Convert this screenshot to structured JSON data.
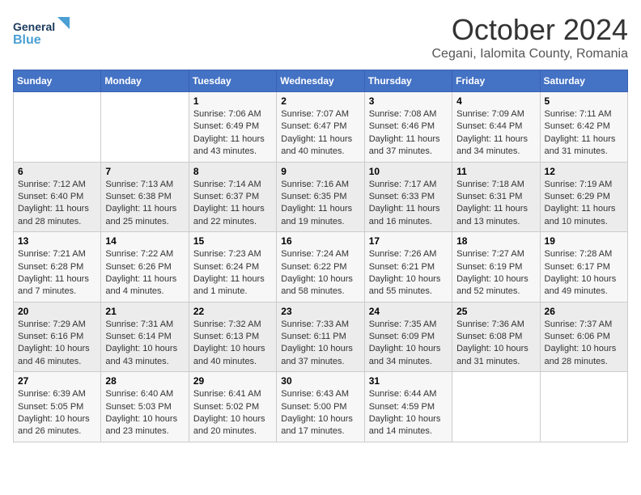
{
  "logo": {
    "line1": "General",
    "line2": "Blue"
  },
  "title": "October 2024",
  "location": "Cegani, Ialomita County, Romania",
  "days_header": [
    "Sunday",
    "Monday",
    "Tuesday",
    "Wednesday",
    "Thursday",
    "Friday",
    "Saturday"
  ],
  "weeks": [
    [
      {
        "day": "",
        "sunrise": "",
        "sunset": "",
        "daylight": ""
      },
      {
        "day": "",
        "sunrise": "",
        "sunset": "",
        "daylight": ""
      },
      {
        "day": "1",
        "sunrise": "Sunrise: 7:06 AM",
        "sunset": "Sunset: 6:49 PM",
        "daylight": "Daylight: 11 hours and 43 minutes."
      },
      {
        "day": "2",
        "sunrise": "Sunrise: 7:07 AM",
        "sunset": "Sunset: 6:47 PM",
        "daylight": "Daylight: 11 hours and 40 minutes."
      },
      {
        "day": "3",
        "sunrise": "Sunrise: 7:08 AM",
        "sunset": "Sunset: 6:46 PM",
        "daylight": "Daylight: 11 hours and 37 minutes."
      },
      {
        "day": "4",
        "sunrise": "Sunrise: 7:09 AM",
        "sunset": "Sunset: 6:44 PM",
        "daylight": "Daylight: 11 hours and 34 minutes."
      },
      {
        "day": "5",
        "sunrise": "Sunrise: 7:11 AM",
        "sunset": "Sunset: 6:42 PM",
        "daylight": "Daylight: 11 hours and 31 minutes."
      }
    ],
    [
      {
        "day": "6",
        "sunrise": "Sunrise: 7:12 AM",
        "sunset": "Sunset: 6:40 PM",
        "daylight": "Daylight: 11 hours and 28 minutes."
      },
      {
        "day": "7",
        "sunrise": "Sunrise: 7:13 AM",
        "sunset": "Sunset: 6:38 PM",
        "daylight": "Daylight: 11 hours and 25 minutes."
      },
      {
        "day": "8",
        "sunrise": "Sunrise: 7:14 AM",
        "sunset": "Sunset: 6:37 PM",
        "daylight": "Daylight: 11 hours and 22 minutes."
      },
      {
        "day": "9",
        "sunrise": "Sunrise: 7:16 AM",
        "sunset": "Sunset: 6:35 PM",
        "daylight": "Daylight: 11 hours and 19 minutes."
      },
      {
        "day": "10",
        "sunrise": "Sunrise: 7:17 AM",
        "sunset": "Sunset: 6:33 PM",
        "daylight": "Daylight: 11 hours and 16 minutes."
      },
      {
        "day": "11",
        "sunrise": "Sunrise: 7:18 AM",
        "sunset": "Sunset: 6:31 PM",
        "daylight": "Daylight: 11 hours and 13 minutes."
      },
      {
        "day": "12",
        "sunrise": "Sunrise: 7:19 AM",
        "sunset": "Sunset: 6:29 PM",
        "daylight": "Daylight: 11 hours and 10 minutes."
      }
    ],
    [
      {
        "day": "13",
        "sunrise": "Sunrise: 7:21 AM",
        "sunset": "Sunset: 6:28 PM",
        "daylight": "Daylight: 11 hours and 7 minutes."
      },
      {
        "day": "14",
        "sunrise": "Sunrise: 7:22 AM",
        "sunset": "Sunset: 6:26 PM",
        "daylight": "Daylight: 11 hours and 4 minutes."
      },
      {
        "day": "15",
        "sunrise": "Sunrise: 7:23 AM",
        "sunset": "Sunset: 6:24 PM",
        "daylight": "Daylight: 11 hours and 1 minute."
      },
      {
        "day": "16",
        "sunrise": "Sunrise: 7:24 AM",
        "sunset": "Sunset: 6:22 PM",
        "daylight": "Daylight: 10 hours and 58 minutes."
      },
      {
        "day": "17",
        "sunrise": "Sunrise: 7:26 AM",
        "sunset": "Sunset: 6:21 PM",
        "daylight": "Daylight: 10 hours and 55 minutes."
      },
      {
        "day": "18",
        "sunrise": "Sunrise: 7:27 AM",
        "sunset": "Sunset: 6:19 PM",
        "daylight": "Daylight: 10 hours and 52 minutes."
      },
      {
        "day": "19",
        "sunrise": "Sunrise: 7:28 AM",
        "sunset": "Sunset: 6:17 PM",
        "daylight": "Daylight: 10 hours and 49 minutes."
      }
    ],
    [
      {
        "day": "20",
        "sunrise": "Sunrise: 7:29 AM",
        "sunset": "Sunset: 6:16 PM",
        "daylight": "Daylight: 10 hours and 46 minutes."
      },
      {
        "day": "21",
        "sunrise": "Sunrise: 7:31 AM",
        "sunset": "Sunset: 6:14 PM",
        "daylight": "Daylight: 10 hours and 43 minutes."
      },
      {
        "day": "22",
        "sunrise": "Sunrise: 7:32 AM",
        "sunset": "Sunset: 6:13 PM",
        "daylight": "Daylight: 10 hours and 40 minutes."
      },
      {
        "day": "23",
        "sunrise": "Sunrise: 7:33 AM",
        "sunset": "Sunset: 6:11 PM",
        "daylight": "Daylight: 10 hours and 37 minutes."
      },
      {
        "day": "24",
        "sunrise": "Sunrise: 7:35 AM",
        "sunset": "Sunset: 6:09 PM",
        "daylight": "Daylight: 10 hours and 34 minutes."
      },
      {
        "day": "25",
        "sunrise": "Sunrise: 7:36 AM",
        "sunset": "Sunset: 6:08 PM",
        "daylight": "Daylight: 10 hours and 31 minutes."
      },
      {
        "day": "26",
        "sunrise": "Sunrise: 7:37 AM",
        "sunset": "Sunset: 6:06 PM",
        "daylight": "Daylight: 10 hours and 28 minutes."
      }
    ],
    [
      {
        "day": "27",
        "sunrise": "Sunrise: 6:39 AM",
        "sunset": "Sunset: 5:05 PM",
        "daylight": "Daylight: 10 hours and 26 minutes."
      },
      {
        "day": "28",
        "sunrise": "Sunrise: 6:40 AM",
        "sunset": "Sunset: 5:03 PM",
        "daylight": "Daylight: 10 hours and 23 minutes."
      },
      {
        "day": "29",
        "sunrise": "Sunrise: 6:41 AM",
        "sunset": "Sunset: 5:02 PM",
        "daylight": "Daylight: 10 hours and 20 minutes."
      },
      {
        "day": "30",
        "sunrise": "Sunrise: 6:43 AM",
        "sunset": "Sunset: 5:00 PM",
        "daylight": "Daylight: 10 hours and 17 minutes."
      },
      {
        "day": "31",
        "sunrise": "Sunrise: 6:44 AM",
        "sunset": "Sunset: 4:59 PM",
        "daylight": "Daylight: 10 hours and 14 minutes."
      },
      {
        "day": "",
        "sunrise": "",
        "sunset": "",
        "daylight": ""
      },
      {
        "day": "",
        "sunrise": "",
        "sunset": "",
        "daylight": ""
      }
    ]
  ]
}
